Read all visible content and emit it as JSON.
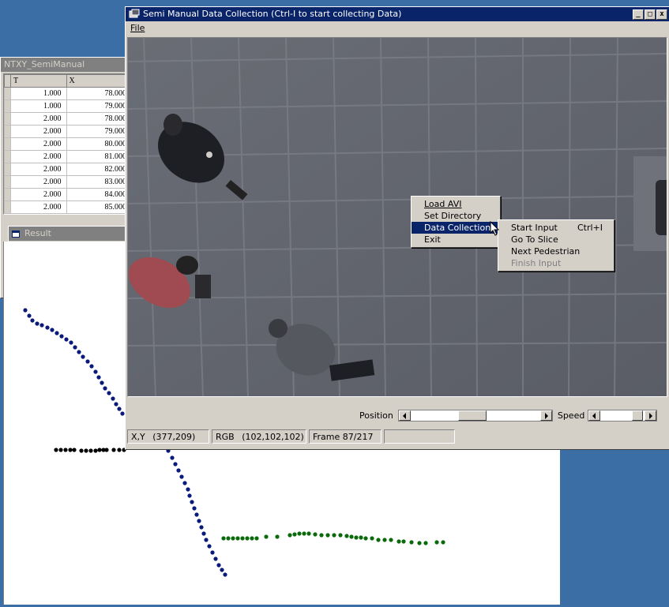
{
  "table_window": {
    "title": "NTXY_SemiManual",
    "columns": [
      "T",
      "X"
    ],
    "rows": [
      [
        "1.000",
        "78.000"
      ],
      [
        "1.000",
        "79.000"
      ],
      [
        "2.000",
        "78.000"
      ],
      [
        "2.000",
        "79.000"
      ],
      [
        "2.000",
        "80.000"
      ],
      [
        "2.000",
        "81.000"
      ],
      [
        "2.000",
        "82.000"
      ],
      [
        "2.000",
        "83.000"
      ],
      [
        "2.000",
        "84.000"
      ],
      [
        "2.000",
        "85.000"
      ]
    ]
  },
  "result_window": {
    "title": "Result"
  },
  "main_window": {
    "title": "Semi Manual Data Collection (Ctrl-I to start collecting Data)",
    "menu_file": "File",
    "btn_min": "_",
    "btn_max": "□",
    "btn_close": "x"
  },
  "context_menu": {
    "items": [
      "Load AVI",
      "Set Directory",
      "Data Collection",
      "Exit"
    ]
  },
  "submenu": {
    "items": [
      {
        "label": "Start Input",
        "shortcut": "Ctrl+I"
      },
      {
        "label": "Go To Slice",
        "shortcut": ""
      },
      {
        "label": "Next Pedestrian",
        "shortcut": ""
      },
      {
        "label": "Finish Input",
        "shortcut": ""
      }
    ]
  },
  "controls": {
    "position_label": "Position",
    "speed_label": "Speed"
  },
  "status": {
    "xy_label": "X,Y",
    "xy_value": "(377,209)",
    "rgb_label": "RGB",
    "rgb_value": "(102,102,102)",
    "frame": "Frame 87/217"
  },
  "colors": {
    "desktop": "#3a6ea5",
    "title_active": "#0a246a",
    "trajectory_blue": "#0a1a7a",
    "trajectory_black": "#000000",
    "trajectory_green": "#0a6a0a"
  }
}
